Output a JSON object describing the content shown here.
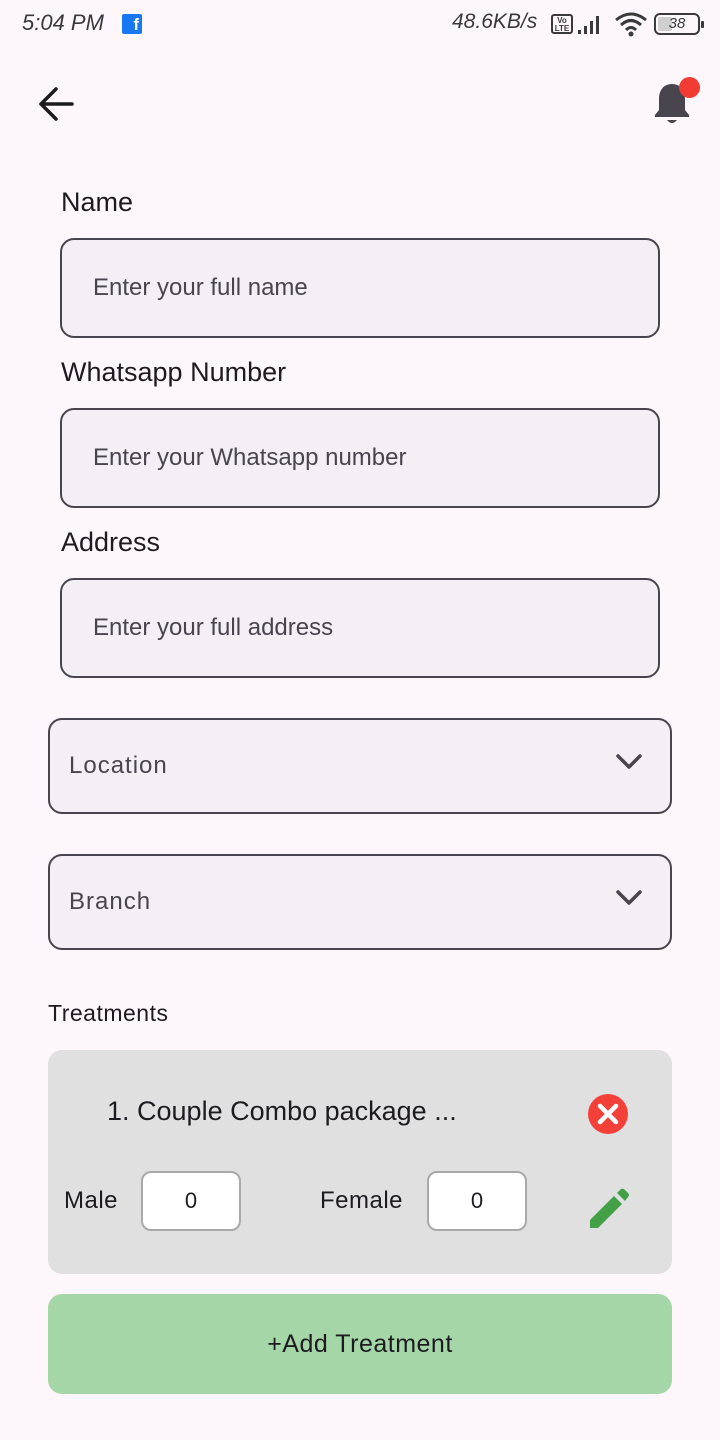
{
  "status_bar": {
    "time": "5:04 PM",
    "app_icon": "facebook-icon",
    "net_speed": "48.6KB/s",
    "volte": "Vo LTE",
    "battery": "38"
  },
  "header": {
    "back_icon": "arrow-left-icon",
    "notification_icon": "bell-icon",
    "notification_dot_color": "#f23b32"
  },
  "form": {
    "name": {
      "label": "Name",
      "placeholder": "Enter your full name",
      "value": ""
    },
    "whatsapp": {
      "label": "Whatsapp Number",
      "placeholder": "Enter your Whatsapp number",
      "value": ""
    },
    "address": {
      "label": "Address",
      "placeholder": "Enter your full address",
      "value": ""
    },
    "location": {
      "label": "Location"
    },
    "branch": {
      "label": "Branch"
    }
  },
  "treatments": {
    "title": "Treatments",
    "items": [
      {
        "name": "1. Couple Combo package ...",
        "male_label": "Male",
        "male_count": "0",
        "female_label": "Female",
        "female_count": "0"
      }
    ],
    "add_button_label": "+Add Treatment"
  },
  "colors": {
    "background": "#fdf7fc",
    "field_bg": "#f3eff4",
    "card_bg": "#e0e0e0",
    "remove_red": "#f3413a",
    "edit_green": "#43a047",
    "add_button_green": "#a5d6a7"
  }
}
